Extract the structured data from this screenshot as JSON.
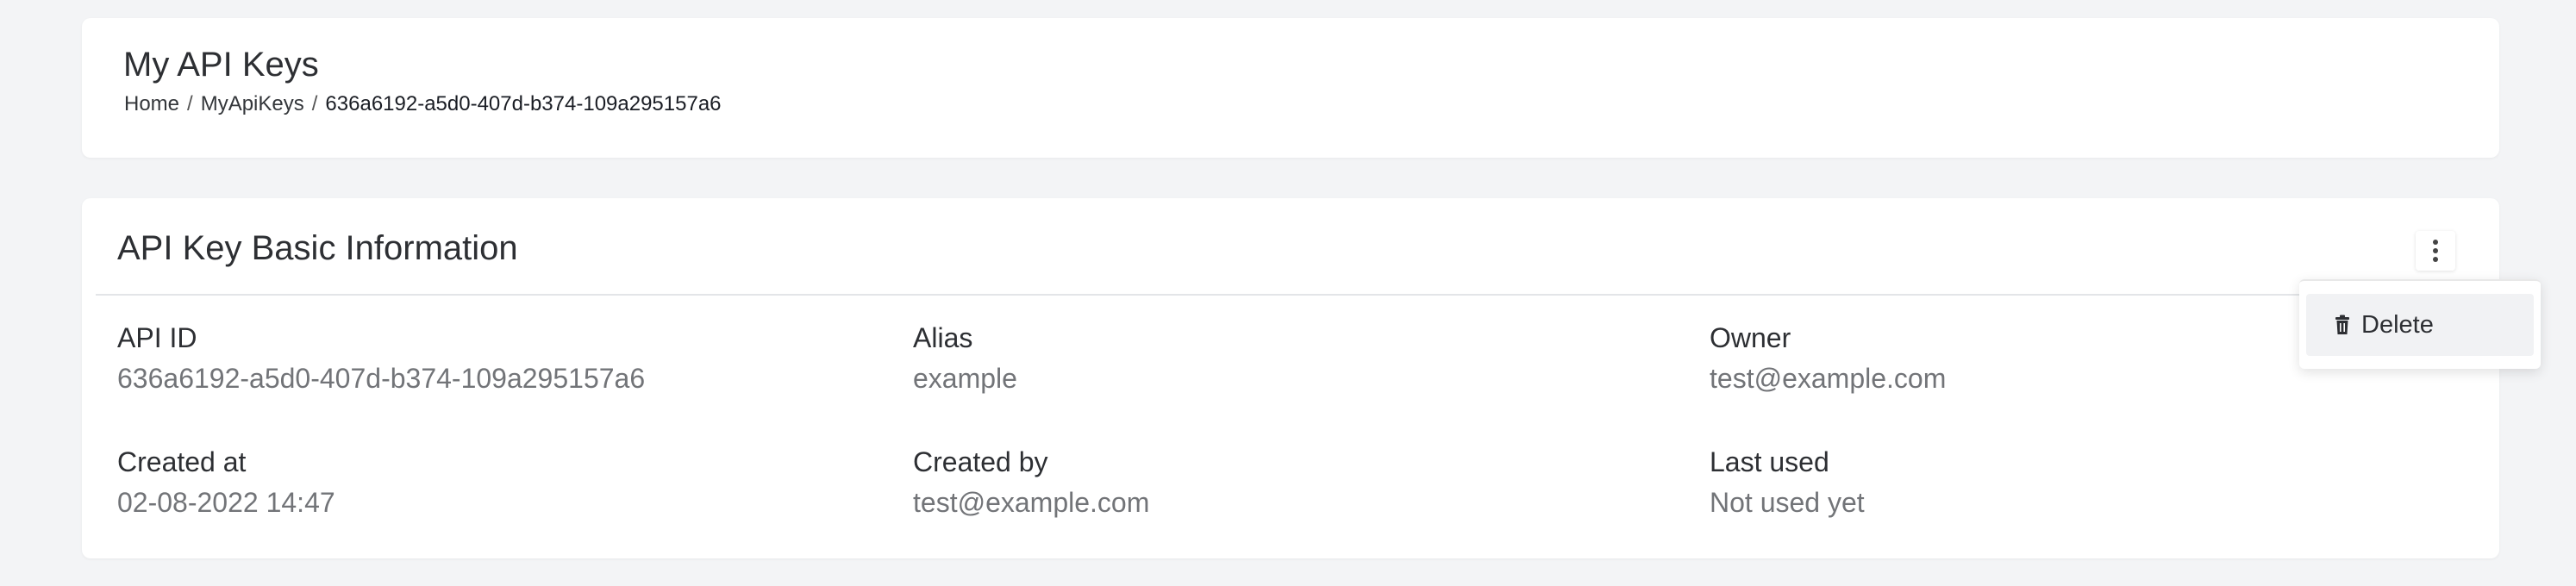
{
  "header": {
    "title": "My API Keys",
    "breadcrumb": {
      "home": "Home",
      "sep1": "/",
      "section": "MyApiKeys",
      "sep2": "/",
      "current": "636a6192-a5d0-407d-b374-109a295157a6"
    }
  },
  "info": {
    "title": "API Key Basic Information",
    "menu": {
      "icon": "kebab-menu-icon",
      "items": [
        {
          "icon": "trash-icon",
          "label": "Delete"
        }
      ]
    },
    "fields": {
      "api_id": {
        "label": "API ID",
        "value": "636a6192-a5d0-407d-b374-109a295157a6"
      },
      "alias": {
        "label": "Alias",
        "value": "example"
      },
      "owner": {
        "label": "Owner",
        "value": "test@example.com"
      },
      "created_at": {
        "label": "Created at",
        "value": "02-08-2022 14:47"
      },
      "created_by": {
        "label": "Created by",
        "value": "test@example.com"
      },
      "last_used": {
        "label": "Last used",
        "value": "Not used yet"
      }
    }
  }
}
